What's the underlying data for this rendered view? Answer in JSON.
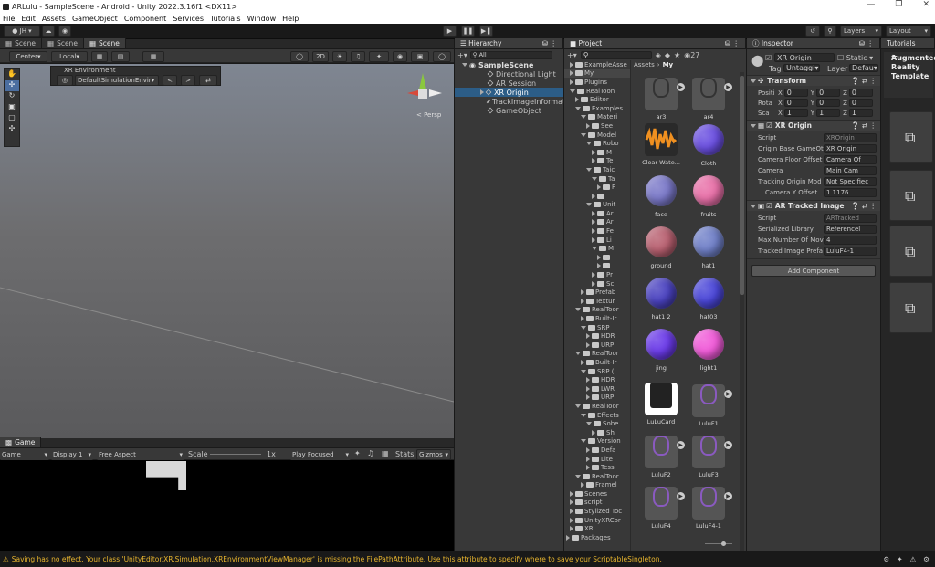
{
  "title": "ARLulu - SampleScene - Android - Unity 2022.3.16f1 <DX11>",
  "menu": [
    "File",
    "Edit",
    "Assets",
    "GameObject",
    "Component",
    "Services",
    "Tutorials",
    "Window",
    "Help"
  ],
  "toolbar": {
    "account": "JH",
    "layers": "Layers",
    "layout": "Layout"
  },
  "scene_tabs": [
    "Scene",
    "Scene",
    "Scene"
  ],
  "scene_toolbar": {
    "pivot": "Center",
    "space": "Local",
    "mode2d": "2D"
  },
  "xr_env": {
    "title": "XR Environment",
    "env": "DefaultSimulationEnvir"
  },
  "gizmo": {
    "label": "< Persp"
  },
  "game": {
    "tab": "Game",
    "dropdown": "Game",
    "display": "Display 1",
    "aspect": "Free Aspect",
    "scale_label": "Scale",
    "scale_value": "1x",
    "play": "Play Focused",
    "stats": "Stats",
    "gizmos": "Gizmos"
  },
  "hierarchy": {
    "tab": "Hierarchy",
    "search": "All",
    "scene": "SampleScene",
    "items": [
      "Directional Light",
      "AR Session",
      "XR Origin",
      "TrackImageInformati",
      "GameObject"
    ]
  },
  "project": {
    "tab": "Project",
    "count": "27",
    "breadcrumb_root": "Assets",
    "breadcrumb_leaf": "My",
    "tree": [
      {
        "d": 0,
        "t": "ExampleAsse",
        "open": false
      },
      {
        "d": 0,
        "t": "My",
        "open": false,
        "sel": true
      },
      {
        "d": 0,
        "t": "Plugins",
        "open": false
      },
      {
        "d": 0,
        "t": "RealToon",
        "open": true
      },
      {
        "d": 1,
        "t": "Editor",
        "open": false
      },
      {
        "d": 1,
        "t": "Examples",
        "open": true
      },
      {
        "d": 2,
        "t": "Materi",
        "open": true
      },
      {
        "d": 3,
        "t": "See",
        "open": false
      },
      {
        "d": 2,
        "t": "Model",
        "open": true
      },
      {
        "d": 3,
        "t": "Robo",
        "open": true
      },
      {
        "d": 4,
        "t": "M",
        "open": false
      },
      {
        "d": 4,
        "t": "Te",
        "open": false
      },
      {
        "d": 3,
        "t": "Taic",
        "open": true
      },
      {
        "d": 4,
        "t": "Ta",
        "open": true
      },
      {
        "d": 5,
        "t": "F",
        "open": false
      },
      {
        "d": 4,
        "t": "",
        "open": false
      },
      {
        "d": 3,
        "t": "Unit",
        "open": true
      },
      {
        "d": 4,
        "t": "Ar",
        "open": false
      },
      {
        "d": 4,
        "t": "Ar",
        "open": false
      },
      {
        "d": 4,
        "t": "Fe",
        "open": false
      },
      {
        "d": 4,
        "t": "Li",
        "open": false
      },
      {
        "d": 4,
        "t": "M",
        "open": true
      },
      {
        "d": 5,
        "t": "",
        "open": false
      },
      {
        "d": 5,
        "t": "",
        "open": false
      },
      {
        "d": 4,
        "t": "Pr",
        "open": false
      },
      {
        "d": 4,
        "t": "Sc",
        "open": false
      },
      {
        "d": 2,
        "t": "Prefab",
        "open": false
      },
      {
        "d": 2,
        "t": "Textur",
        "open": false
      },
      {
        "d": 1,
        "t": "RealToor",
        "open": true
      },
      {
        "d": 2,
        "t": "Built-Ir",
        "open": false
      },
      {
        "d": 2,
        "t": "SRP",
        "open": true
      },
      {
        "d": 3,
        "t": "HDR",
        "open": false
      },
      {
        "d": 3,
        "t": "URP",
        "open": false
      },
      {
        "d": 1,
        "t": "RealToor",
        "open": true
      },
      {
        "d": 2,
        "t": "Built-Ir",
        "open": false
      },
      {
        "d": 2,
        "t": "SRP (L",
        "open": true
      },
      {
        "d": 3,
        "t": "HDR",
        "open": false
      },
      {
        "d": 3,
        "t": "LWR",
        "open": false
      },
      {
        "d": 3,
        "t": "URP",
        "open": false
      },
      {
        "d": 1,
        "t": "RealToor",
        "open": true
      },
      {
        "d": 2,
        "t": "Effects",
        "open": true
      },
      {
        "d": 3,
        "t": "Sobe",
        "open": true
      },
      {
        "d": 4,
        "t": "Sh",
        "open": false
      },
      {
        "d": 2,
        "t": "Version",
        "open": true
      },
      {
        "d": 3,
        "t": "Defa",
        "open": false
      },
      {
        "d": 3,
        "t": "Lite",
        "open": false
      },
      {
        "d": 3,
        "t": "Tess",
        "open": false
      },
      {
        "d": 1,
        "t": "RealToor",
        "open": true
      },
      {
        "d": 2,
        "t": "Framel",
        "open": false
      },
      {
        "d": 0,
        "t": "Scenes",
        "open": false
      },
      {
        "d": 0,
        "t": "script",
        "open": false
      },
      {
        "d": 0,
        "t": "Stylized Toc",
        "open": false
      },
      {
        "d": 0,
        "t": "UnityXRCor",
        "open": false
      },
      {
        "d": 0,
        "t": "XR",
        "open": false
      },
      {
        "d": -1,
        "t": "Packages",
        "open": false
      }
    ],
    "assets": [
      {
        "n": "ar3",
        "k": "model"
      },
      {
        "n": "ar4",
        "k": "model"
      },
      {
        "n": "Clear Wate...",
        "k": "audio"
      },
      {
        "n": "Cloth",
        "k": "sphere",
        "c": "#6a4fe0"
      },
      {
        "n": "face",
        "k": "sphere",
        "c": "#7a78c8"
      },
      {
        "n": "fruits",
        "k": "sphere",
        "c": "#e870a8"
      },
      {
        "n": "ground",
        "k": "sphere",
        "c": "#b86070"
      },
      {
        "n": "hat1",
        "k": "sphere",
        "c": "#7080c8"
      },
      {
        "n": "hat1 2",
        "k": "sphere",
        "c": "#4a42c0"
      },
      {
        "n": "hat03",
        "k": "sphere",
        "c": "#4a46d8"
      },
      {
        "n": "jing",
        "k": "sphere",
        "c": "#6a3ae8"
      },
      {
        "n": "light1",
        "k": "sphere",
        "c": "#f05ad8"
      },
      {
        "n": "LuLuCard",
        "k": "image"
      },
      {
        "n": "LuluF1",
        "k": "model2"
      },
      {
        "n": "LuluF2",
        "k": "model2"
      },
      {
        "n": "LuluF3",
        "k": "model2"
      },
      {
        "n": "LuluF4",
        "k": "model2"
      },
      {
        "n": "LuluF4-1",
        "k": "model2"
      }
    ]
  },
  "inspector": {
    "tab": "Inspector",
    "name": "XR Origin",
    "static": "Static",
    "tag_label": "Tag",
    "tag": "Untaggi",
    "layer_label": "Layer",
    "layer": "Defau",
    "transform": {
      "title": "Transform",
      "rows": [
        {
          "l": "Positi",
          "x": "0",
          "y": "0",
          "z": "0"
        },
        {
          "l": "Rota",
          "x": "0",
          "y": "0",
          "z": "0"
        },
        {
          "l": "Sca",
          "x": "1",
          "y": "1",
          "z": "1"
        }
      ]
    },
    "xr_origin": {
      "title": "XR Origin",
      "fields": [
        {
          "l": "Script",
          "v": "XROrigin"
        },
        {
          "l": "Origin Base GameOt",
          "v": "XR Origin"
        },
        {
          "l": "Camera Floor Offset",
          "v": "Camera Of"
        },
        {
          "l": "Camera",
          "v": "Main Cam"
        },
        {
          "l": "Tracking Origin Mod",
          "v": "Not Specifiec"
        },
        {
          "l": "Camera Y Offset",
          "v": "1.1176"
        }
      ]
    },
    "ar_tracked": {
      "title": "AR Tracked Image",
      "fields": [
        {
          "l": "Script",
          "v": "ARTracked"
        },
        {
          "l": "Serialized Library",
          "v": "Referencel"
        },
        {
          "l": "Max Number Of Mov",
          "v": "4"
        },
        {
          "l": "Tracked Image Prefa",
          "v": "LuluF4-1"
        }
      ]
    },
    "add_component": "Add Component"
  },
  "tutorials": {
    "tab": "Tutorials",
    "title": "Augmented Reality Template"
  },
  "status": "Saving has no effect. Your class 'UnityEditor.XR.Simulation.XREnvironmentViewManager' is missing the FilePathAttribute. Use this attribute to specify where to save your ScriptableSingleton."
}
